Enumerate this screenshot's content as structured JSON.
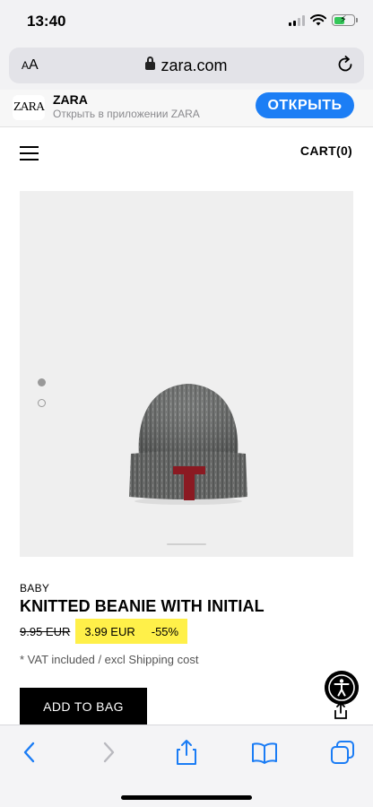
{
  "status_bar": {
    "time": "13:40",
    "signal_icon": "signal-bars-icon",
    "wifi_icon": "wifi-icon",
    "battery_icon": "battery-charging-icon"
  },
  "browser": {
    "text_size_label": "AA",
    "url": "zara.com",
    "reload_icon": "reload-icon"
  },
  "app_banner": {
    "logo": "ZARA",
    "app_name": "ZARA",
    "subtitle": "Открыть в приложении ZARA",
    "open_label": "ОТКРЫТЬ"
  },
  "header": {
    "menu_icon": "hamburger-menu-icon",
    "cart_label": "CART(0)"
  },
  "product": {
    "image_count": 2,
    "active_image": 1,
    "category": "BABY",
    "name": "KNITTED BEANIE WITH INITIAL",
    "old_price": "9.95 EUR",
    "sale_price": "3.99 EUR",
    "discount": "-55%",
    "vat_note": "* VAT included / excl Shipping cost",
    "add_to_bag_label": "ADD TO BAG"
  },
  "colors": {
    "open_button": "#1c7ef5",
    "sale_highlight": "#fff049",
    "beanie_initial": "#8b1a22",
    "browser_accent": "#1a7cf5"
  },
  "toolbar": {
    "items": [
      "back-icon",
      "forward-icon",
      "share-icon",
      "bookmarks-icon",
      "tabs-icon"
    ]
  }
}
